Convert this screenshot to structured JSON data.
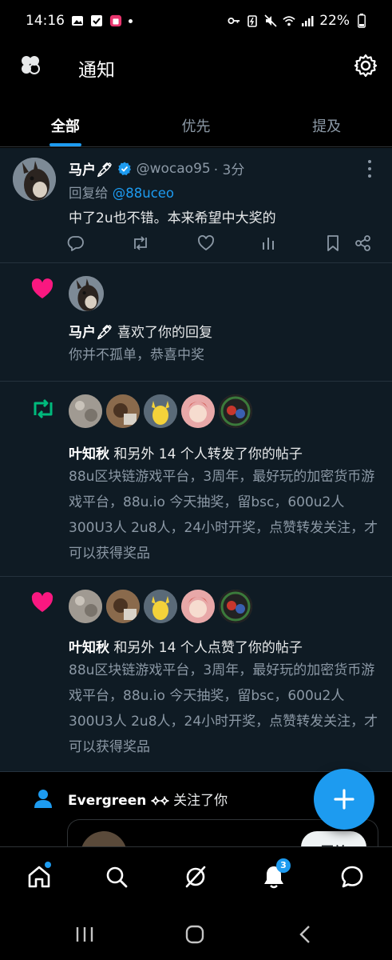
{
  "status_bar": {
    "time": "14:16",
    "battery": "22%"
  },
  "header": {
    "title": "通知"
  },
  "tabs": [
    {
      "label": "全部",
      "active": true
    },
    {
      "label": "优先",
      "active": false
    },
    {
      "label": "提及",
      "active": false
    }
  ],
  "tweet": {
    "name": "马户🖋",
    "handle": "@wocao95",
    "time": "· 3分",
    "reply_prefix": "回复给",
    "reply_to": "@88uceo",
    "text": "中了2u也不错。本来希望中大奖的"
  },
  "like_notification": {
    "name": "马户🖋",
    "action": "喜欢了你的回复",
    "snippet": "你并不孤单，恭喜中奖"
  },
  "repost_notification": {
    "name": "叶知秋",
    "action": "和另外 14 个人转发了你的帖子",
    "snippet": "88u区块链游戏平台，3周年，最好玩的加密货币游戏平台，88u.io 今天抽奖，留bsc，600u2人 300U3人 2u8人，24小时开奖，点赞转发关注，才可以获得奖品"
  },
  "like_post_notification": {
    "name": "叶知秋",
    "action": "和另外 14 个人点赞了你的帖子",
    "snippet": "88u区块链游戏平台，3周年，最好玩的加密货币游戏平台，88u.io 今天抽奖，留bsc，600u2人 300U3人 2u8人，24小时开奖，点赞转发关注，才可以获得奖品"
  },
  "follow_notification": {
    "name": "Evergreen ⟡⟡",
    "action": "关注了你",
    "button": "回关"
  },
  "bottom_nav": {
    "notifications_badge": "3"
  },
  "colors": {
    "accent": "#1d9bf0",
    "like": "#f91880",
    "repost": "#00ba7c",
    "card_bg": "#0f1b24"
  }
}
